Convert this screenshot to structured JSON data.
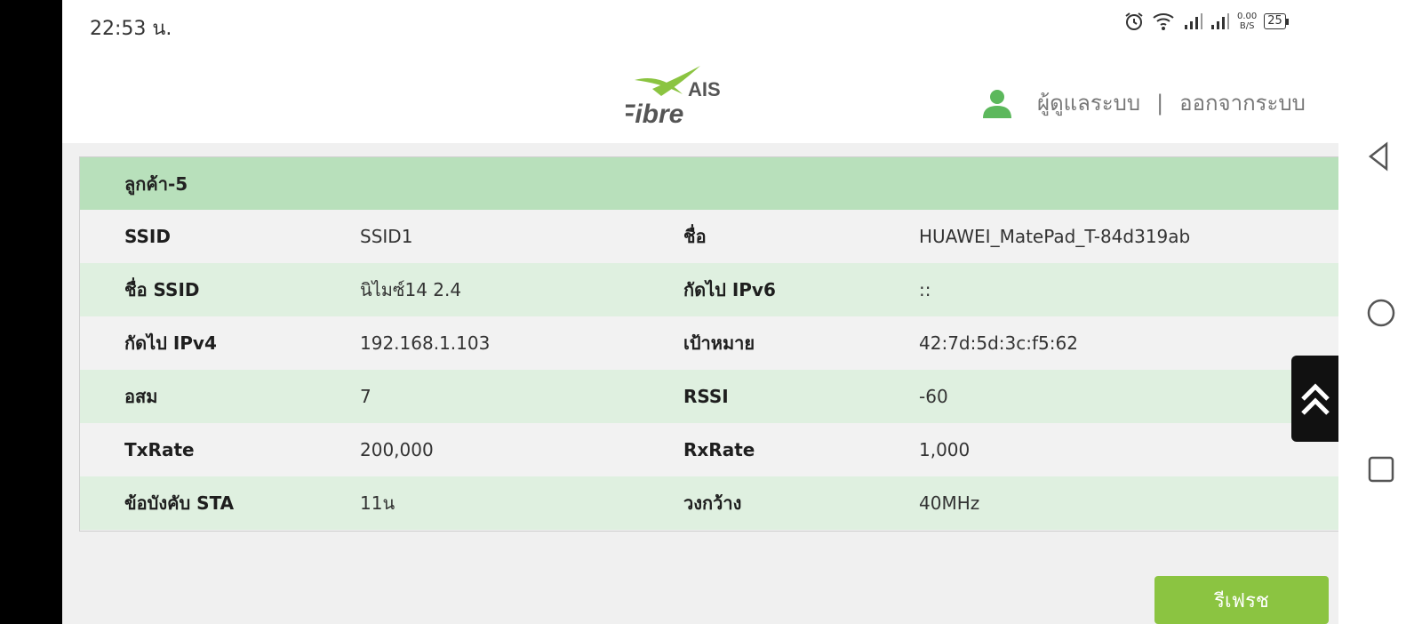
{
  "status_bar": {
    "time": "22:53 น.",
    "net_speed_value": "0.00",
    "net_speed_unit": "B/S",
    "battery": "25"
  },
  "header": {
    "logo_top": "AIS",
    "logo_bottom": "Fibre",
    "user_role": "ผู้ดูแลระบบ",
    "separator": "|",
    "logout": "ออกจากระบบ"
  },
  "client": {
    "title": "ลูกค้า-5",
    "rows": [
      {
        "label1": "SSID",
        "value1": "SSID1",
        "label2": "ชื่อ",
        "value2": "HUAWEI_MatePad_T-84d319ab"
      },
      {
        "label1": "ชื่อ SSID",
        "value1": "นิไมซ์14 2.4",
        "label2": "กัดไป IPv6",
        "value2": "::"
      },
      {
        "label1": "กัดไป IPv4",
        "value1": "192.168.1.103",
        "label2": "เป้าหมาย",
        "value2": "42:7d:5d:3c:f5:62"
      },
      {
        "label1": "อสม",
        "value1": "7",
        "label2": "RSSI",
        "value2": "-60"
      },
      {
        "label1": "TxRate",
        "value1": "200,000",
        "label2": "RxRate",
        "value2": "1,000"
      },
      {
        "label1": "ข้อบังคับ STA",
        "value1": "11น",
        "label2": "วงกว้าง",
        "value2": "40MHz"
      }
    ]
  },
  "actions": {
    "refresh": "รีเฟรช"
  },
  "colors": {
    "header_green": "#b8e0bb",
    "row_green": "#dff0e0",
    "button_green": "#8bc441"
  }
}
